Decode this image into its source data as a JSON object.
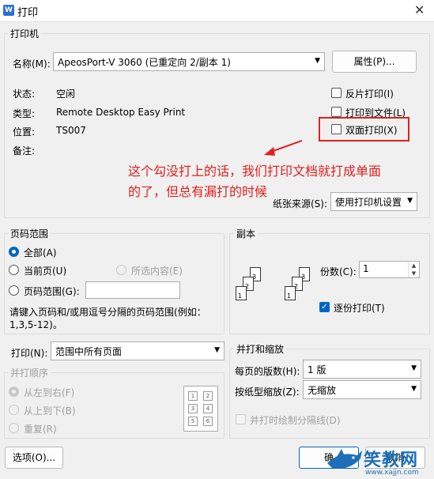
{
  "window": {
    "title": "打印",
    "app_icon_letter": "W",
    "close_glyph": "✕"
  },
  "printer": {
    "group_title": "打印机",
    "name_label": "名称(M):",
    "name_value": "ApeosPort-V 3060 (已重定向 2/副本 1)",
    "properties_button": "属性(P)...",
    "status_label": "状态:",
    "status_value": "空闲",
    "type_label": "类型:",
    "type_value": "Remote Desktop Easy Print",
    "location_label": "位置:",
    "location_value": "TS007",
    "comment_label": "备注:",
    "reverse_print": "反片打印(I)",
    "print_to_file": "打印到文件(L)",
    "duplex": "双面打印(X)",
    "paper_source_label": "纸张来源(S):",
    "paper_source_value": "使用打印机设置"
  },
  "annotation": {
    "line1": "这个勾没打上的话，我们打印文档就打成单面",
    "line2": "的了，但总有漏打的时候",
    "color": "#e02020"
  },
  "page_range": {
    "group_title": "页码范围",
    "all": "全部(A)",
    "current": "当前页(U)",
    "selection": "所选内容(E)",
    "pages": "页码范围(G):",
    "pages_value": "",
    "hint_line1": "请键入页码和/或用逗号分隔的页码范围(例如：",
    "hint_line2": "1,3,5-12)。"
  },
  "print_what": {
    "label": "打印(N):",
    "value": "范围中所有页面"
  },
  "order": {
    "group_title": "并打顺序",
    "left_right": "从左到右(F)",
    "top_bottom": "从上到下(B)",
    "repeat": "重复(R)",
    "grid": [
      "1",
      "2",
      "3",
      "4",
      "5",
      "6"
    ]
  },
  "copies": {
    "group_title": "副本",
    "count_label": "份数(C):",
    "count_value": "1",
    "collate": "逐份打印(T)",
    "stack_pages": [
      "3",
      "2",
      "1"
    ]
  },
  "zoom": {
    "group_title": "并打和缩放",
    "per_sheet_label": "每页的版数(H):",
    "per_sheet_value": "1 版",
    "scale_label": "按纸型缩放(Z):",
    "scale_value": "无缩放",
    "draw_borders": "并打时绘制分隔线(D)"
  },
  "footer": {
    "options_button": "选项(O)...",
    "ok_button": "确",
    "cancel_button": "取消"
  },
  "watermark": {
    "brand": "笑教网",
    "url": "www.xajjn.com"
  }
}
